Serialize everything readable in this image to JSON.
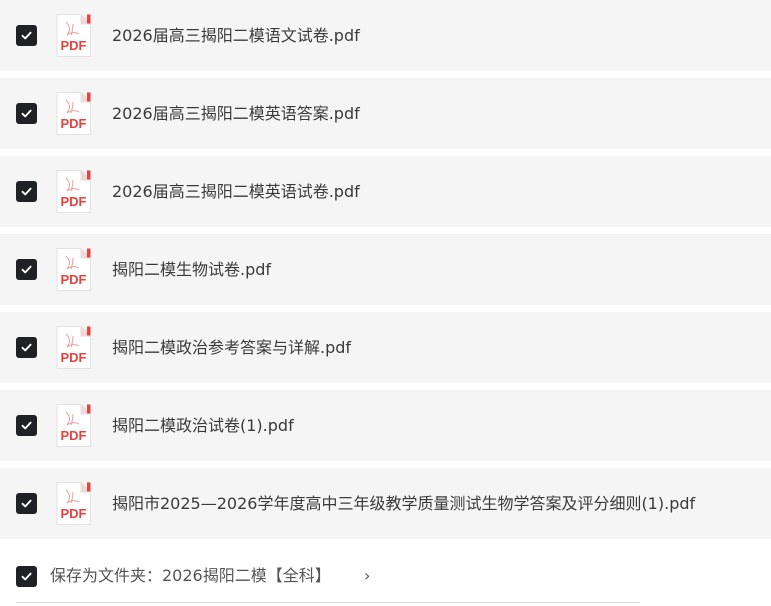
{
  "files": [
    {
      "name": "2026届高三揭阳二模语文试卷.pdf",
      "checked": true,
      "icon": "pdf-file-icon",
      "icon_label": "PDF"
    },
    {
      "name": "2026届高三揭阳二模英语答案.pdf",
      "checked": true,
      "icon": "pdf-file-icon",
      "icon_label": "PDF"
    },
    {
      "name": "2026届高三揭阳二模英语试卷.pdf",
      "checked": true,
      "icon": "pdf-file-icon",
      "icon_label": "PDF"
    },
    {
      "name": "揭阳二模生物试卷.pdf",
      "checked": true,
      "icon": "pdf-file-icon",
      "icon_label": "PDF"
    },
    {
      "name": "揭阳二模政治参考答案与详解.pdf",
      "checked": true,
      "icon": "pdf-file-icon",
      "icon_label": "PDF"
    },
    {
      "name": "揭阳二模政治试卷(1).pdf",
      "checked": true,
      "icon": "pdf-file-icon",
      "icon_label": "PDF"
    },
    {
      "name": "揭阳市2025—2026学年度高中三年级教学质量测试生物学答案及评分细则(1).pdf",
      "checked": true,
      "icon": "pdf-file-icon",
      "icon_label": "PDF"
    }
  ],
  "save_as_folder": {
    "checked": true,
    "label": "保存为文件夹：2026揭阳二模【全科】",
    "chevron": "›"
  },
  "colors": {
    "row_background": "#f5f5f6",
    "checkbox_fill": "#202124",
    "pdf_accent": "#e8423f",
    "text": "#3a3a3a"
  }
}
